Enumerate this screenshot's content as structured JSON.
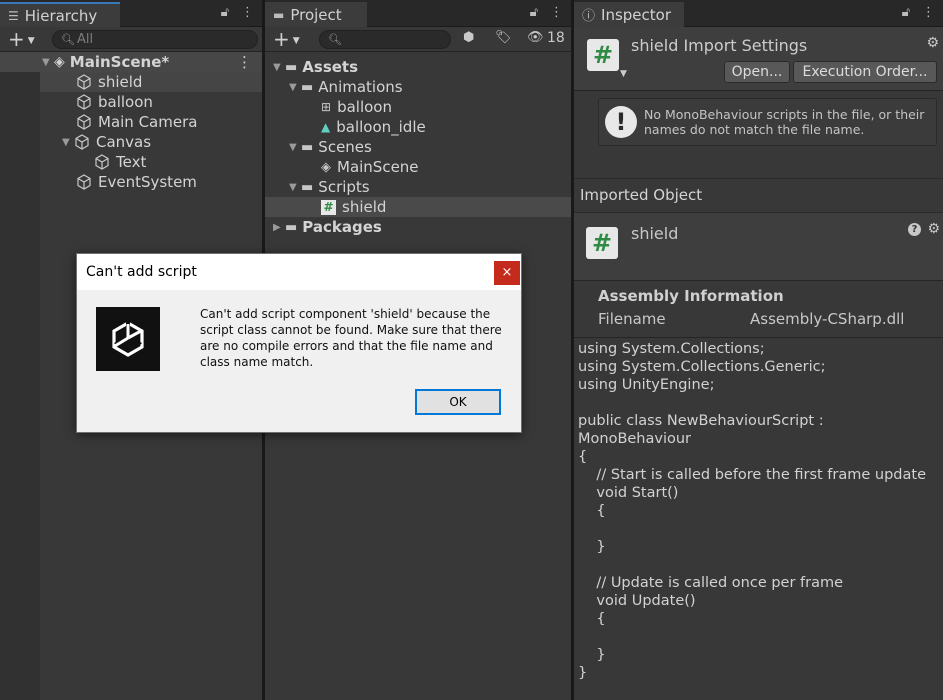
{
  "hierarchy": {
    "tab_label": "Hierarchy",
    "search_placeholder": "All",
    "scene_name": "MainScene*",
    "items": [
      {
        "label": "shield"
      },
      {
        "label": "balloon"
      },
      {
        "label": "Main Camera"
      },
      {
        "label": "Canvas"
      },
      {
        "label": "Text"
      },
      {
        "label": "EventSystem"
      }
    ]
  },
  "project": {
    "tab_label": "Project",
    "hidden_count": "18",
    "tree": {
      "assets": "Assets",
      "animations": "Animations",
      "balloon_anim": "balloon",
      "balloon_idle": "balloon_idle",
      "scenes": "Scenes",
      "main_scene": "MainScene",
      "scripts": "Scripts",
      "shield_script": "shield",
      "packages": "Packages"
    }
  },
  "inspector": {
    "tab_label": "Inspector",
    "title": "shield Import Settings",
    "open_button": "Open...",
    "execution_order_button": "Execution Order...",
    "warning_text": "No MonoBehaviour scripts in the file, or their names do not match the file name.",
    "imported_object_header": "Imported Object",
    "imported_object_name": "shield",
    "assembly_header": "Assembly Information",
    "filename_label": "Filename",
    "filename_value": "Assembly-CSharp.dll",
    "code_text": "using System.Collections;\nusing System.Collections.Generic;\nusing UnityEngine;\n\npublic class NewBehaviourScript :\nMonoBehaviour\n{\n    // Start is called before the first frame update\n    void Start()\n    {\n\n    }\n\n    // Update is called once per frame\n    void Update()\n    {\n\n    }\n}"
  },
  "dialog": {
    "title": "Can't add script",
    "message": "Can't add script component 'shield' because the script class cannot be found. Make sure that there are no compile errors and that the file name and class name match.",
    "ok_label": "OK",
    "close_glyph": "×"
  },
  "colors": {
    "editor_bg": "#383838",
    "tab_accent": "#3a79bb",
    "selection": "#2c5d87",
    "script_icon_green": "#2f8a43",
    "dialog_close": "#c42b1c"
  }
}
